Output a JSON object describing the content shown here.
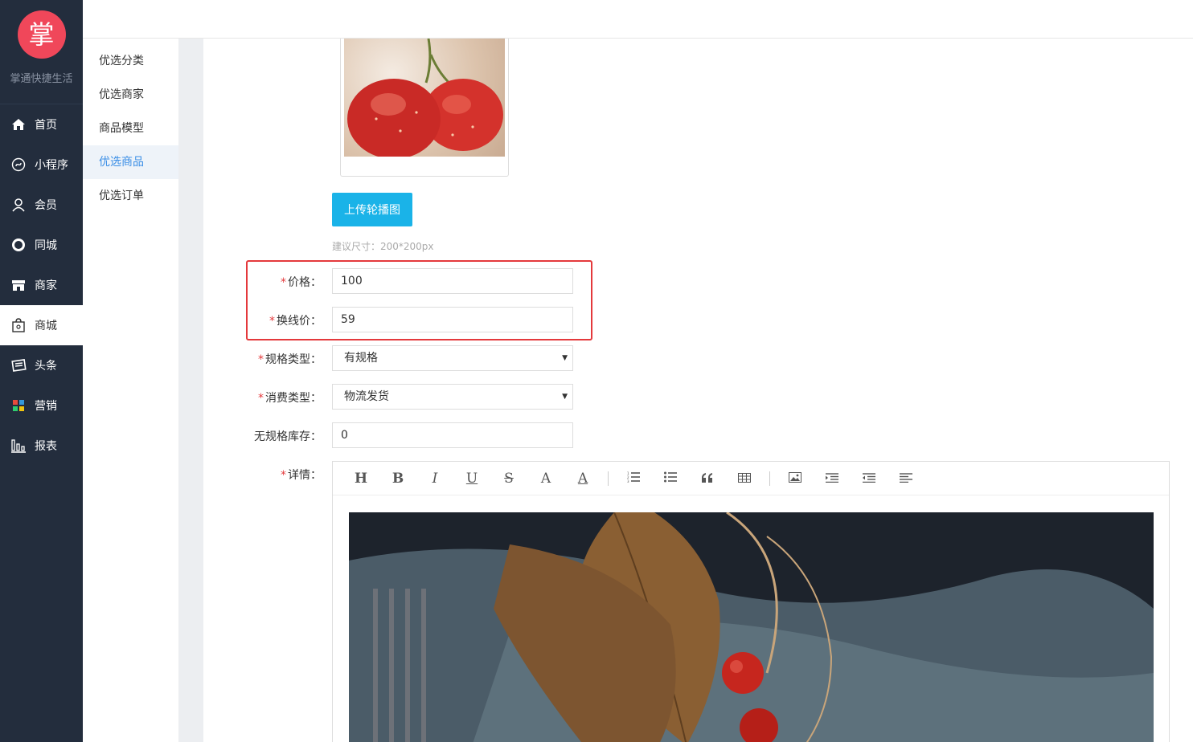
{
  "app": {
    "logo_char": "掌",
    "brand": "掌通快捷生活"
  },
  "nav": [
    {
      "label": "首页",
      "icon": "home-icon"
    },
    {
      "label": "小程序",
      "icon": "miniprogram-icon"
    },
    {
      "label": "会员",
      "icon": "user-icon"
    },
    {
      "label": "同城",
      "icon": "circle-icon"
    },
    {
      "label": "商家",
      "icon": "store-icon"
    },
    {
      "label": "商城",
      "icon": "shop-bag-icon",
      "active": true
    },
    {
      "label": "头条",
      "icon": "newspaper-icon"
    },
    {
      "label": "营销",
      "icon": "grid-icon"
    },
    {
      "label": "报表",
      "icon": "bar-chart-icon"
    }
  ],
  "submenu": [
    {
      "label": "优选分类"
    },
    {
      "label": "优选商家"
    },
    {
      "label": "商品模型"
    },
    {
      "label": "优选商品",
      "active": true
    },
    {
      "label": "优选订单"
    }
  ],
  "form": {
    "upload_button": "上传轮播图",
    "upload_hint": "建议尺寸：200*200px",
    "price": {
      "label": "价格：",
      "value": "100",
      "required": true
    },
    "original_price": {
      "label": "换线价：",
      "value": "59",
      "required": true
    },
    "spec_type": {
      "label": "规格类型：",
      "value": "有规格",
      "required": true
    },
    "consume_type": {
      "label": "消费类型：",
      "value": "物流发货",
      "required": true
    },
    "stock": {
      "label": "无规格库存：",
      "value": "0",
      "required": false
    },
    "detail": {
      "label": "详情：",
      "required": true
    }
  },
  "required_mark": "*",
  "toolbar": {
    "heading": "H",
    "bold": "B",
    "italic": "I",
    "underline": "U",
    "strike": "S",
    "font_color": "A",
    "bg_color": "A"
  },
  "colors": {
    "sidebar_bg": "#232d3d",
    "logo_bg": "#f0475a",
    "primary_button": "#1ab3e8",
    "highlight": "#e4393c",
    "submenu_active_text": "#3a8ee6"
  }
}
